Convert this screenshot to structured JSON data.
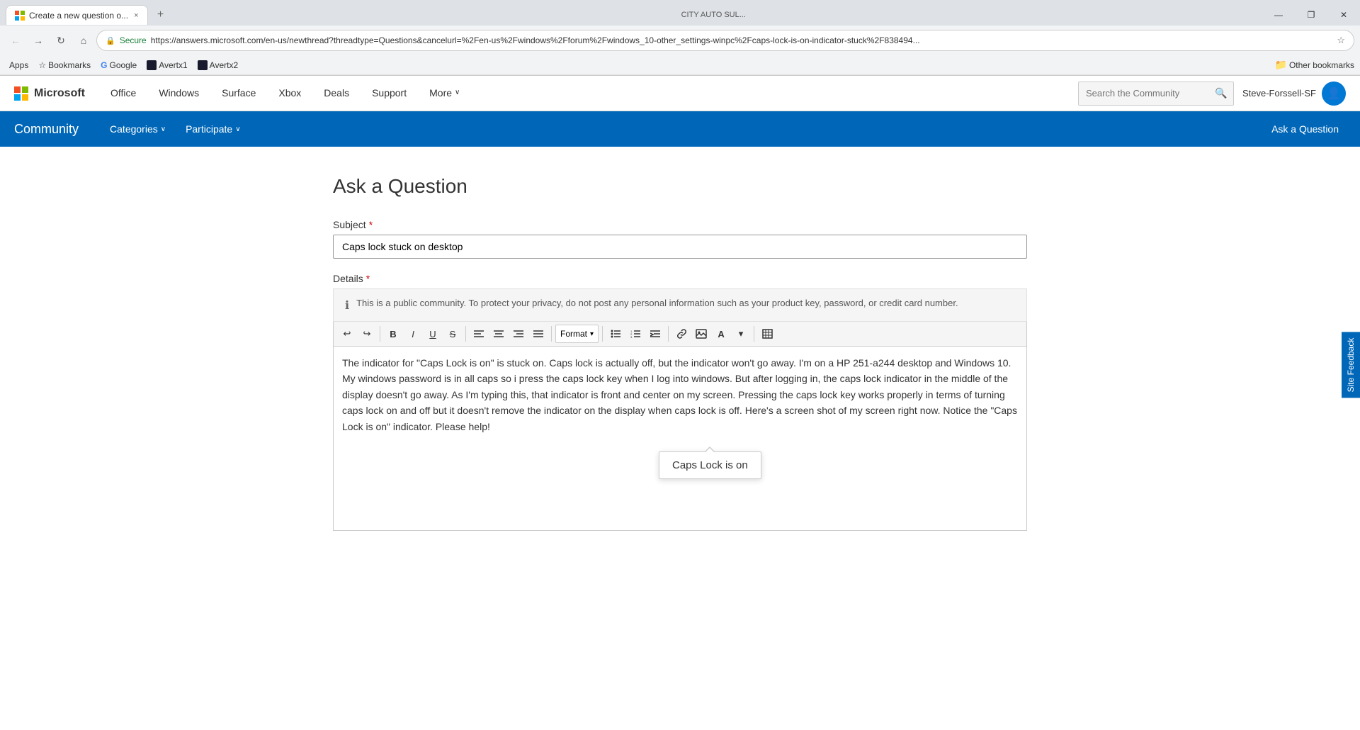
{
  "browser": {
    "tab_title": "Create a new question o...",
    "tab_close": "×",
    "title_bar_text": "CITY AUTO SUL...",
    "win_minimize": "—",
    "win_maximize": "❐",
    "win_close": "✕",
    "nav_back": "←",
    "nav_forward": "→",
    "nav_refresh": "↻",
    "nav_home": "⌂",
    "secure_label": "Secure",
    "url": "https://answers.microsoft.com/en-us/newthread?threadtype=Questions&cancelurl=%2Fen-us%2Fwindows%2Fforum%2Fwindows_10-other_settings-winpc%2Fcaps-lock-is-on-indicator-stuck%2F838494...",
    "star": "☆",
    "bookmarks": {
      "apps": "Apps",
      "bookmarks": "Bookmarks",
      "google": "Google",
      "avertx1": "Avertx1",
      "avertx2": "Avertx2",
      "other_label": "Other bookmarks"
    }
  },
  "msheader": {
    "logo_text": "Microsoft",
    "nav": [
      "Office",
      "Windows",
      "Surface",
      "Xbox",
      "Deals",
      "Support",
      "More"
    ],
    "more_arrow": "∨",
    "search_placeholder": "Search the Community",
    "username": "Steve-Forssell-SF"
  },
  "community": {
    "title": "Community",
    "categories": "Categories",
    "categories_arrow": "∨",
    "participate": "Participate",
    "participate_arrow": "∨",
    "ask_question": "Ask a Question"
  },
  "form": {
    "page_title": "Ask a Question",
    "subject_label": "Subject",
    "required_marker": "*",
    "subject_value": "Caps lock stuck on desktop",
    "details_label": "Details",
    "privacy_text": "This is a public community. To protect your privacy, do not post any personal information such as your product key, password, or credit card number.",
    "editor_body": "The indicator for \"Caps Lock is on\" is stuck on.  Caps lock is actually off, but the indicator won't go away.  I'm on a HP 251-a244 desktop and Windows 10.  My windows password is in all caps so i press the caps lock key when I log into windows. But after logging in, the caps lock indicator in the middle of the display doesn't go away. As I'm typing this, that indicator is front and center on my screen. Pressing the caps lock key works properly in terms of turning caps lock on and off but it doesn't remove the indicator on the display when caps lock is off. Here's a screen shot of my screen right now.  Notice the \"Caps Lock is on\" indicator.  Please help!",
    "caps_lock_tooltip": "Caps Lock is on",
    "format_label": "Format"
  },
  "toolbar": {
    "undo": "↩",
    "redo": "↪",
    "bold": "B",
    "italic": "I",
    "underline": "U",
    "strikethrough": "S̶",
    "align_left": "≡",
    "align_center": "≡",
    "align_right": "≡",
    "align_justify": "≡",
    "format_label": "Format",
    "unordered_list": "≔",
    "ordered_list": "≔",
    "indent": "→|",
    "link": "🔗",
    "image": "🖼",
    "font_color": "A",
    "more": "▾",
    "table": "▦"
  },
  "feedback": {
    "label": "Site Feedback"
  }
}
